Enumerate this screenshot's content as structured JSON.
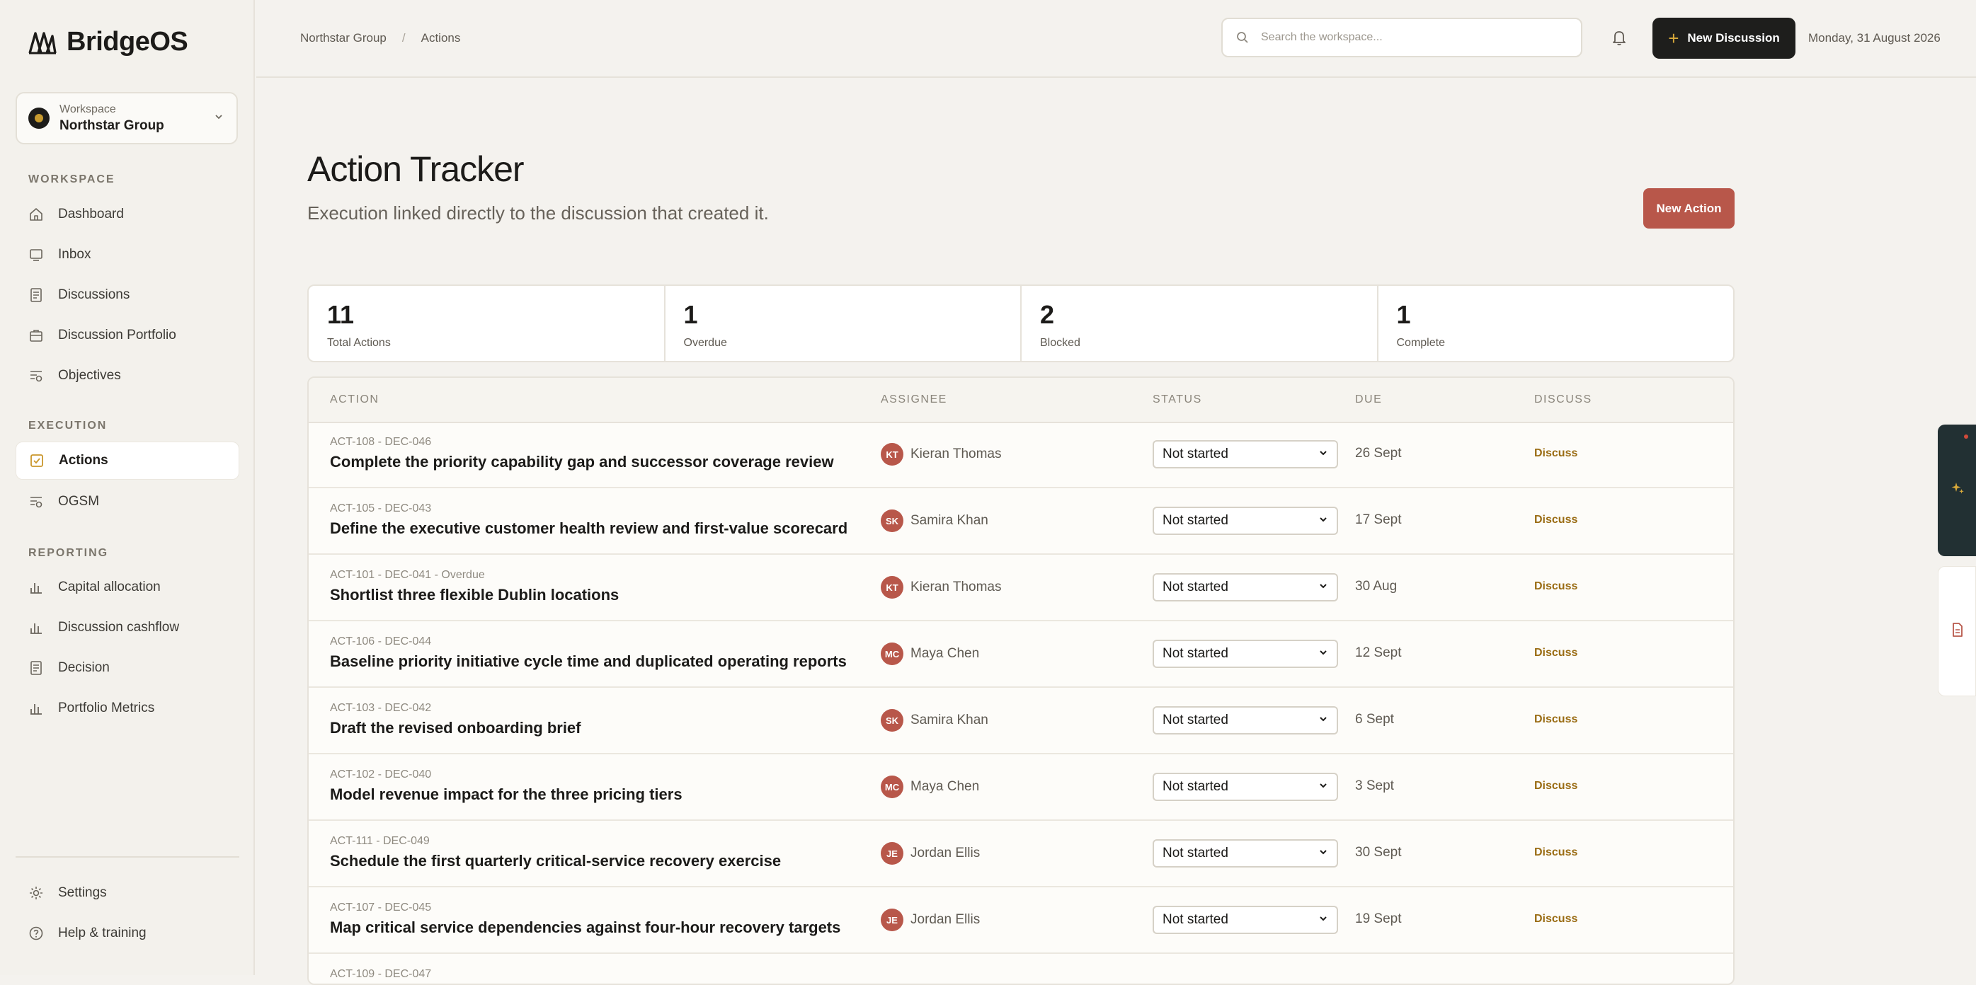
{
  "app": {
    "name": "BridgeOS"
  },
  "workspace": {
    "label": "Workspace",
    "name": "Northstar Group"
  },
  "sidebar": {
    "sections": [
      {
        "title": "WORKSPACE"
      },
      {
        "title": "EXECUTION"
      },
      {
        "title": "REPORTING"
      }
    ],
    "items": [
      {
        "label": "Dashboard",
        "icon": "home-icon"
      },
      {
        "label": "Inbox",
        "icon": "inbox-icon"
      },
      {
        "label": "Discussions",
        "icon": "document-icon"
      },
      {
        "label": "Discussion Portfolio",
        "icon": "briefcase-icon"
      },
      {
        "label": "Objectives",
        "icon": "objectives-icon"
      },
      {
        "label": "Actions",
        "icon": "checkbox-icon",
        "active": true
      },
      {
        "label": "OGSM",
        "icon": "objectives-icon"
      },
      {
        "label": "Capital allocation",
        "icon": "bar-chart-icon"
      },
      {
        "label": "Discussion cashflow",
        "icon": "bar-chart-icon"
      },
      {
        "label": "Decision",
        "icon": "document-icon"
      },
      {
        "label": "Portfolio Metrics",
        "icon": "bar-chart-icon"
      }
    ],
    "footer": [
      {
        "label": "Settings",
        "icon": "gear-icon"
      },
      {
        "label": "Help & training",
        "icon": "help-icon"
      }
    ]
  },
  "topbar": {
    "breadcrumb": [
      "Northstar Group",
      "/",
      "Actions"
    ],
    "search_placeholder": "Search the workspace...",
    "new_discussion_label": "New Discussion",
    "date": "Monday, 31 August 2026"
  },
  "page": {
    "title": "Action Tracker",
    "subtitle": "Execution linked directly to the discussion that created it.",
    "new_action_label": "New Action"
  },
  "stats": [
    {
      "value": "11",
      "label": "Total Actions"
    },
    {
      "value": "1",
      "label": "Overdue"
    },
    {
      "value": "2",
      "label": "Blocked"
    },
    {
      "value": "1",
      "label": "Complete"
    }
  ],
  "table": {
    "headers": [
      "ACTION",
      "ASSIGNEE",
      "STATUS",
      "DUE",
      "DISCUSS"
    ],
    "rows": [
      {
        "id": "ACT-108 - DEC-046",
        "title": "Complete the priority capability gap and successor coverage review",
        "initials": "KT",
        "assignee": "Kieran Thomas",
        "status": "Not started",
        "due": "26 Sept",
        "discuss": "Discuss"
      },
      {
        "id": "ACT-105 - DEC-043",
        "title": "Define the executive customer health review and first-value scorecard",
        "initials": "SK",
        "assignee": "Samira Khan",
        "status": "Not started",
        "due": "17 Sept",
        "discuss": "Discuss"
      },
      {
        "id": "ACT-101 - DEC-041 - Overdue",
        "title": "Shortlist three flexible Dublin locations",
        "initials": "KT",
        "assignee": "Kieran Thomas",
        "status": "Not started",
        "due": "30 Aug",
        "discuss": "Discuss"
      },
      {
        "id": "ACT-106 - DEC-044",
        "title": "Baseline priority initiative cycle time and duplicated operating reports",
        "initials": "MC",
        "assignee": "Maya Chen",
        "status": "Not started",
        "due": "12 Sept",
        "discuss": "Discuss"
      },
      {
        "id": "ACT-103 - DEC-042",
        "title": "Draft the revised onboarding brief",
        "initials": "SK",
        "assignee": "Samira Khan",
        "status": "Not started",
        "due": "6 Sept",
        "discuss": "Discuss"
      },
      {
        "id": "ACT-102 - DEC-040",
        "title": "Model revenue impact for the three pricing tiers",
        "initials": "MC",
        "assignee": "Maya Chen",
        "status": "Not started",
        "due": "3 Sept",
        "discuss": "Discuss"
      },
      {
        "id": "ACT-111 - DEC-049",
        "title": "Schedule the first quarterly critical-service recovery exercise",
        "initials": "JE",
        "assignee": "Jordan Ellis",
        "status": "Not started",
        "due": "30 Sept",
        "discuss": "Discuss"
      },
      {
        "id": "ACT-107 - DEC-045",
        "title": "Map critical service dependencies against four-hour recovery targets",
        "initials": "JE",
        "assignee": "Jordan Ellis",
        "status": "Not started",
        "due": "19 Sept",
        "discuss": "Discuss"
      },
      {
        "id": "ACT-109 - DEC-047",
        "title": "",
        "initials": "",
        "assignee": "",
        "status": "",
        "due": "",
        "discuss": ""
      }
    ]
  },
  "colors": {
    "accent": "#b8574a",
    "dark": "#1e1e1c",
    "gold": "#c79a2f",
    "discuss_link": "#9a6c14"
  }
}
